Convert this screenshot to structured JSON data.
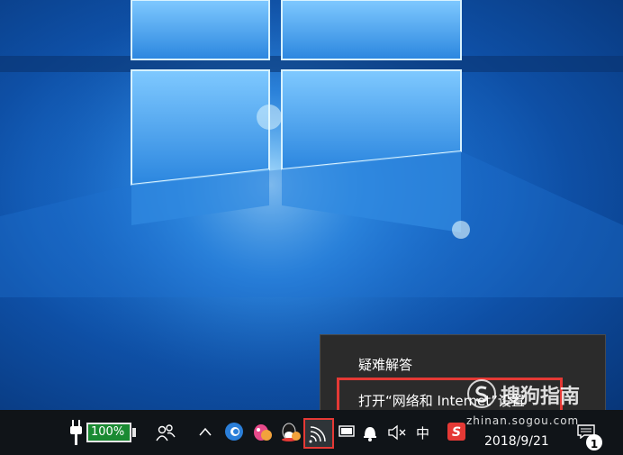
{
  "context_menu": {
    "items": [
      "疑难解答",
      "打开“网络和 Internet”设置"
    ]
  },
  "taskbar": {
    "battery_percent": "100%",
    "ime_label": "中",
    "sogou_label": "S",
    "date": "2018/9/21",
    "notification_count": "1"
  },
  "watermark": {
    "brand": "搜狗指南",
    "url": "zhinan.sogou.com"
  },
  "colors": {
    "highlight_box": "#e53935",
    "battery_fill": "#1a8a32",
    "menu_bg": "#2b2b2b",
    "taskbar_bg": "#101418"
  }
}
